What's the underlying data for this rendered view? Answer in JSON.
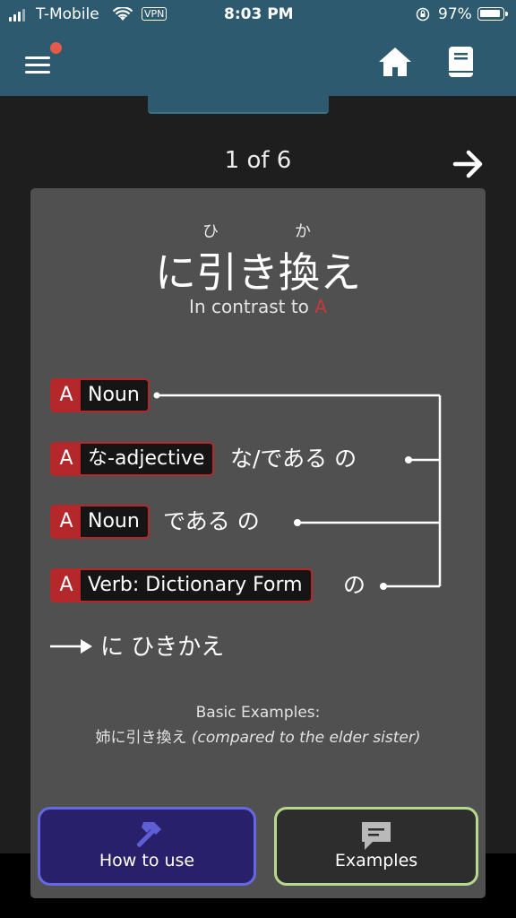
{
  "status_bar": {
    "carrier": "T-Mobile",
    "vpn": "VPN",
    "time": "8:03 PM",
    "battery": "97%",
    "battery_level": 0.97
  },
  "header": {
    "menu_icon": "hamburger-icon",
    "notification_dot_color": "#e55a4a",
    "home_icon": "home-icon",
    "book_icon": "book-icon"
  },
  "pager": {
    "text": "1 of 6",
    "next_icon": "arrow-right-icon"
  },
  "grammar": {
    "furigana": [
      "ひ",
      "か"
    ],
    "title": "に引き換え",
    "subtitle_prefix": "In contrast to",
    "subtitle_marker": "A"
  },
  "formation": [
    {
      "tag": "A",
      "type": "Noun",
      "tail": ""
    },
    {
      "tag": "A",
      "type": "な-adjective",
      "tail": "な/である  の"
    },
    {
      "tag": "A",
      "type": "Noun",
      "tail": "である  の"
    },
    {
      "tag": "A",
      "type": "Verb: Dictionary Form",
      "tail": "の"
    }
  ],
  "result": {
    "text": "に  ひきかえ"
  },
  "examples": {
    "heading": "Basic Examples:",
    "jp": "姉に引き換え",
    "en": "(compared to the elder sister)"
  },
  "buttons": {
    "how_to_use": "How to use",
    "examples": "Examples"
  },
  "colors": {
    "header": "#2d5a6e",
    "card": "#505050",
    "tag_red": "#b4282c",
    "how_border": "#6669dd",
    "examples_border": "#b8d88e"
  }
}
